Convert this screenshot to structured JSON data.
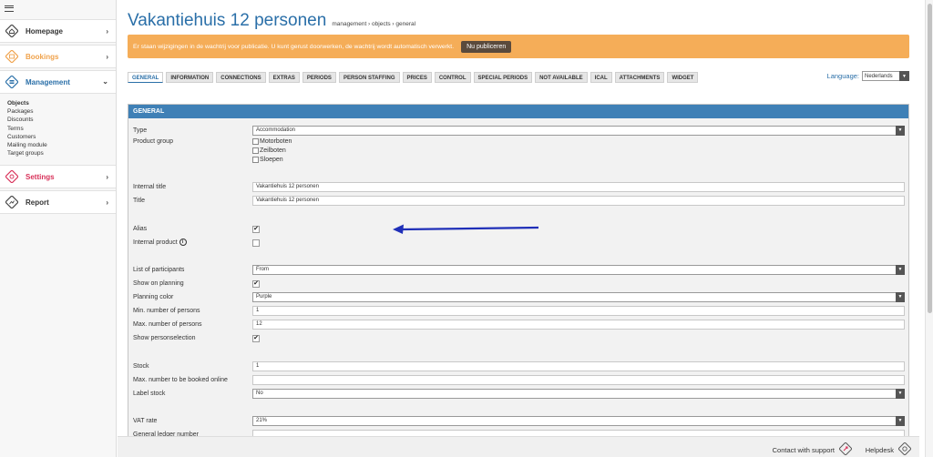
{
  "sidebar": {
    "items": [
      {
        "label": "Homepage",
        "color": "#333333",
        "icon": "home-icon"
      },
      {
        "label": "Bookings",
        "color": "#f0a24b",
        "icon": "bookings-icon"
      },
      {
        "label": "Management",
        "color": "#2a6fa8",
        "icon": "management-icon"
      },
      {
        "label": "Settings",
        "color": "#d8325a",
        "icon": "settings-icon"
      },
      {
        "label": "Report",
        "color": "#333333",
        "icon": "report-icon"
      }
    ],
    "management_sub": [
      "Objects",
      "Packages",
      "Discounts",
      "Terms",
      "Customers",
      "Mailing module",
      "Target groups"
    ]
  },
  "header": {
    "title": "Vakantiehuis 12 personen",
    "breadcrumb": "management › objects › general"
  },
  "banner": {
    "text": "Er staan wijzigingen in de wachtrij voor publicatie. U kunt gerust doorwerken, de wachtrij wordt automatisch verwerkt.",
    "button": "Nu publiceren"
  },
  "tabs": [
    "GENERAL",
    "INFORMATION",
    "CONNECTIONS",
    "EXTRAS",
    "PERIODS",
    "PERSON STAFFING",
    "PRICES",
    "CONTROL",
    "SPECIAL PERIODS",
    "NOT AVAILABLE",
    "ICAL",
    "ATTACHMENTS",
    "WIDGET"
  ],
  "language": {
    "label": "Language:",
    "value": "Nederlands"
  },
  "panel": {
    "heading": "GENERAL",
    "type": {
      "label": "Type",
      "value": "Accommodation"
    },
    "product_group": {
      "label": "Product group",
      "options": [
        "Motorboten",
        "Zeilboten",
        "Sloepen"
      ]
    },
    "internal_title": {
      "label": "Internal title",
      "value": "Vakantiehuis 12 personen"
    },
    "title": {
      "label": "Title",
      "value": "Vakantiehuis 12 personen"
    },
    "alias": {
      "label": "Alias",
      "check": "✔"
    },
    "internal_product": {
      "label": "Internal product",
      "info": "i"
    },
    "participants": {
      "label": "List of participants",
      "value": "From"
    },
    "show_planning": {
      "label": "Show on planning",
      "check": "✔"
    },
    "planning_color": {
      "label": "Planning color",
      "value": "Purple"
    },
    "min_persons": {
      "label": "Min. number of persons",
      "value": "1"
    },
    "max_persons": {
      "label": "Max. number of persons",
      "value": "12"
    },
    "show_personselection": {
      "label": "Show personselection",
      "check": "✔"
    },
    "stock": {
      "label": "Stock",
      "value": "1"
    },
    "max_online": {
      "label": "Max. number to be booked online",
      "value": ""
    },
    "label_stock": {
      "label": "Label stock",
      "value": "No"
    },
    "vat": {
      "label": "VAT rate",
      "value": "21%"
    },
    "ledger": {
      "label": "General ledger number",
      "value": ""
    }
  },
  "footer": {
    "support": "Contact with support",
    "helpdesk": "Helpdesk"
  },
  "colors": {
    "accent": "#2a6fa8",
    "banner": "#f5ad58",
    "arrow": "#1f2fb8"
  }
}
